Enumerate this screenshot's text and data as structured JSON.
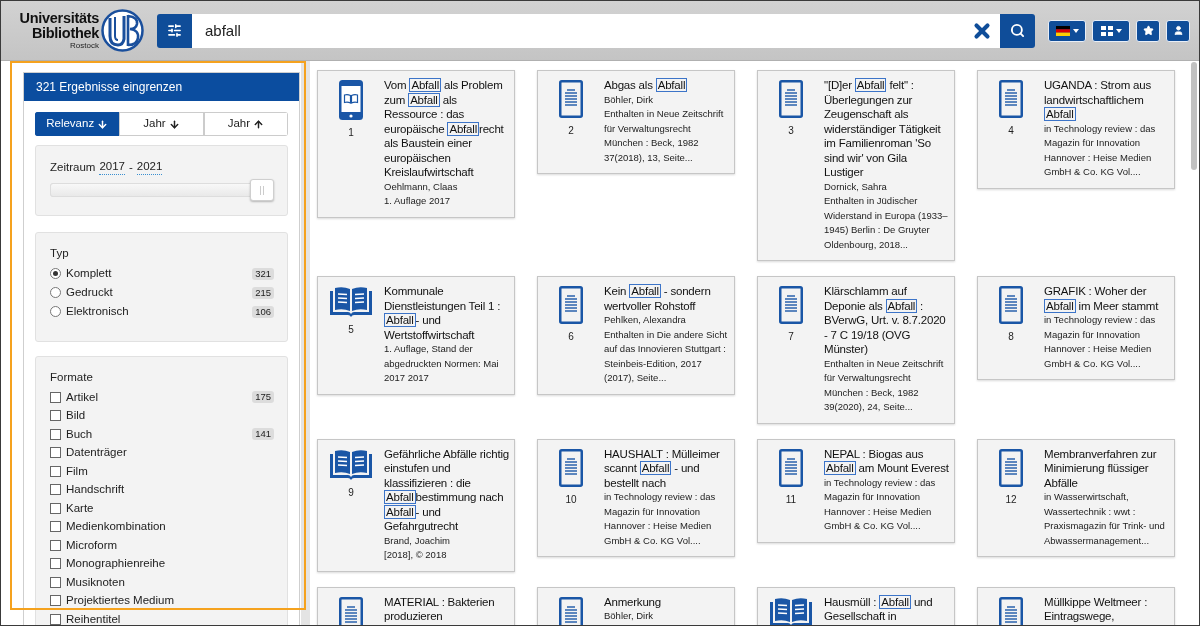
{
  "header": {
    "logo": {
      "line_1": "Universitäts",
      "line_2": "Bibliothek",
      "line_3": "Rostock"
    },
    "search": {
      "value": "abfall"
    }
  },
  "sidebar": {
    "title": "321 Ergebnisse eingrenzen",
    "sort": [
      {
        "label": "Relevanz",
        "kind": "down",
        "selected": true
      },
      {
        "label": "Jahr",
        "kind": "down",
        "selected": false
      },
      {
        "label": "Jahr",
        "kind": "up",
        "selected": false
      }
    ],
    "period": {
      "label": "Zeitraum",
      "from": "2017",
      "separator": "-",
      "to": "2021",
      "level": 1
    },
    "type": {
      "title": "Typ",
      "options": [
        {
          "label": "Komplett",
          "count": "321",
          "selected": true
        },
        {
          "label": "Gedruckt",
          "count": "215",
          "selected": false
        },
        {
          "label": "Elektronisch",
          "count": "106",
          "selected": false
        }
      ]
    },
    "formats": {
      "title": "Formate",
      "options": [
        {
          "label": "Artikel",
          "count": "175",
          "checked": false
        },
        {
          "label": "Bild",
          "checked": false
        },
        {
          "label": "Buch",
          "count": "141",
          "checked": false
        },
        {
          "label": "Datenträger",
          "checked": false
        },
        {
          "label": "Film",
          "checked": false
        },
        {
          "label": "Handschrift",
          "checked": false
        },
        {
          "label": "Karte",
          "checked": false
        },
        {
          "label": "Medienkombination",
          "checked": false
        },
        {
          "label": "Microform",
          "checked": false
        },
        {
          "label": "Monographienreihe",
          "checked": false
        },
        {
          "label": "Musiknoten",
          "checked": false
        },
        {
          "label": "Projektiertes Medium",
          "checked": false
        },
        {
          "label": "Reihentitel",
          "checked": false
        }
      ]
    }
  },
  "results": [
    {
      "kind": "ebook",
      "number": "1",
      "title": [
        {
          "text": "Vom ",
          "highlighted": false
        },
        {
          "text": "Abfall",
          "highlighted": true
        },
        {
          "text": " als Problem zum ",
          "highlighted": false
        },
        {
          "text": "Abfall",
          "highlighted": true
        },
        {
          "text": " als Ressource : das europäische ",
          "highlighted": false
        },
        {
          "text": "Abfall",
          "highlighted": true
        },
        {
          "text": "recht als Baustein einer europäischen Kreislaufwirtschaft",
          "highlighted": false
        }
      ],
      "details": [
        "Oehlmann, Claas",
        "1. Auflage 2017"
      ]
    },
    {
      "kind": "article",
      "number": "2",
      "title": [
        {
          "text": "Abgas als ",
          "highlighted": false
        },
        {
          "text": "Abfall",
          "highlighted": true
        }
      ],
      "details": [
        "Böhler, Dirk",
        "Enthalten in Neue Zeitschrift für Verwaltungsrecht München : Beck, 1982 37(2018), 13, Seite..."
      ]
    },
    {
      "kind": "article",
      "number": "3",
      "title": [
        {
          "text": "\"[D]er ",
          "highlighted": false
        },
        {
          "text": "Abfall",
          "highlighted": true
        },
        {
          "text": " felt\" : Überlegungen zur Zeugenschaft als widerständiger Tätigkeit im Familienroman 'So sind wir' von Gila Lustiger",
          "highlighted": false
        }
      ],
      "details": [
        "Dornick, Sahra",
        "Enthalten in Jüdischer Widerstand in Europa (1933–1945) Berlin : De Gruyter Oldenbourg, 2018..."
      ]
    },
    {
      "kind": "article",
      "number": "4",
      "title": [
        {
          "text": "UGANDA : Strom aus landwirtschaftlichem ",
          "highlighted": false
        },
        {
          "text": "Abfall",
          "highlighted": true
        }
      ],
      "details": [
        "in Technology review : das Magazin für Innovation Hannover : Heise Medien GmbH & Co. KG Vol...."
      ]
    },
    {
      "kind": "book",
      "number": "5",
      "title": [
        {
          "text": "Kommunale Dienstleistungen Teil 1 : ",
          "highlighted": false
        },
        {
          "text": "Abfall",
          "highlighted": true
        },
        {
          "text": "- und Wertstoffwirtschaft",
          "highlighted": false
        }
      ],
      "details": [
        "1. Auflage, Stand der abgedruckten Normen: Mai 2017 2017"
      ]
    },
    {
      "kind": "article",
      "number": "6",
      "title": [
        {
          "text": "Kein ",
          "highlighted": false
        },
        {
          "text": "Abfall",
          "highlighted": true
        },
        {
          "text": " - sondern wertvoller Rohstoff",
          "highlighted": false
        }
      ],
      "details": [
        "Pehlken, Alexandra",
        "Enthalten in Die andere Sicht auf das Innovieren Stuttgart : Steinbeis-Edition, 2017 (2017), Seite..."
      ]
    },
    {
      "kind": "article",
      "number": "7",
      "title": [
        {
          "text": "Klärschlamm auf Deponie als ",
          "highlighted": false
        },
        {
          "text": "Abfall",
          "highlighted": true
        },
        {
          "text": " : BVerwG, Urt. v. 8.7.2020 - 7 C 19/18 (OVG Münster)",
          "highlighted": false
        }
      ],
      "details": [
        "Enthalten in Neue Zeitschrift für Verwaltungsrecht München : Beck, 1982 39(2020), 24, Seite..."
      ]
    },
    {
      "kind": "article",
      "number": "8",
      "title": [
        {
          "text": "GRAFIK : Woher der ",
          "highlighted": false
        },
        {
          "text": "Abfall",
          "highlighted": true
        },
        {
          "text": " im Meer stammt",
          "highlighted": false
        }
      ],
      "details": [
        "in Technology review : das Magazin für Innovation Hannover : Heise Medien GmbH & Co. KG Vol...."
      ]
    },
    {
      "kind": "book",
      "number": "9",
      "title": [
        {
          "text": "Gefährliche Abfälle richtig einstufen und klassifizieren : die ",
          "highlighted": false
        },
        {
          "text": "Abfall",
          "highlighted": true
        },
        {
          "text": "bestimmung nach ",
          "highlighted": false
        },
        {
          "text": "Abfall",
          "highlighted": true
        },
        {
          "text": "- und Gefahrgutrecht",
          "highlighted": false
        }
      ],
      "details": [
        "Brand, Joachim",
        "[2018], © 2018"
      ]
    },
    {
      "kind": "article",
      "number": "10",
      "title": [
        {
          "text": "HAUSHALT : Mülleimer scannt ",
          "highlighted": false
        },
        {
          "text": "Abfall",
          "highlighted": true
        },
        {
          "text": " - und bestellt nach",
          "highlighted": false
        }
      ],
      "details": [
        "in Technology review : das Magazin für Innovation Hannover : Heise Medien GmbH & Co. KG Vol...."
      ]
    },
    {
      "kind": "article",
      "number": "11",
      "title": [
        {
          "text": "NEPAL : Biogas aus ",
          "highlighted": false
        },
        {
          "text": "Abfall",
          "highlighted": true
        },
        {
          "text": " am Mount Everest",
          "highlighted": false
        }
      ],
      "details": [
        "in Technology review : das Magazin für Innovation Hannover : Heise Medien GmbH & Co. KG Vol...."
      ]
    },
    {
      "kind": "article",
      "number": "12",
      "title": [
        {
          "text": "Membranverfahren zur Minimierung flüssiger Abfälle",
          "highlighted": false
        }
      ],
      "details": [
        "in Wasserwirtschaft, Wassertechnik : wwt : Praxismagazin für Trink- und Abwassermanagement..."
      ]
    },
    {
      "kind": "article",
      "title": [
        {
          "text": "MATERIAL : Bakterien produzieren",
          "highlighted": false
        }
      ]
    },
    {
      "kind": "article",
      "title": [
        {
          "text": "Anmerkung",
          "highlighted": false
        }
      ],
      "details": [
        "Böhler, Dirk"
      ]
    },
    {
      "kind": "book",
      "title": [
        {
          "text": "Hausmüll : ",
          "highlighted": false
        },
        {
          "text": "Abfall",
          "highlighted": true
        },
        {
          "text": " und Gesellschaft in",
          "highlighted": false
        }
      ]
    },
    {
      "kind": "article",
      "title": [
        {
          "text": "Müllkippe Weltmeer : Eintragswege,",
          "highlighted": false
        }
      ]
    }
  ]
}
